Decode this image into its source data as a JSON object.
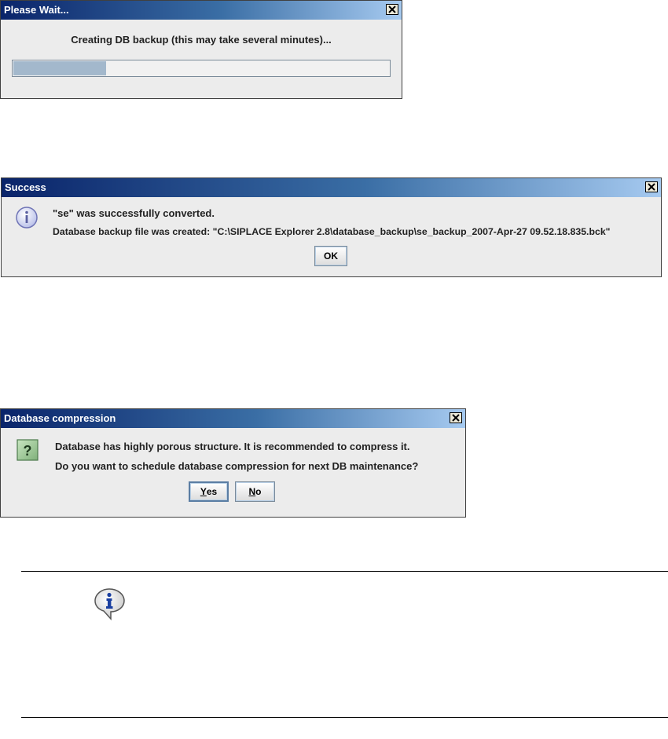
{
  "wait_dialog": {
    "title": "Please Wait...",
    "message": "Creating DB backup (this may take several minutes)...",
    "progress": 0.25
  },
  "success_dialog": {
    "title": "Success",
    "line1": "\"se\" was successfully converted.",
    "line2": "Database backup file was created: \"C:\\SIPLACE Explorer 2.8\\database_backup\\se_backup_2007-Apr-27 09.52.18.835.bck\"",
    "ok_label": "OK",
    "icon": "info-icon"
  },
  "compression_dialog": {
    "title": "Database compression",
    "line1": "Database has highly porous structure. It is recommended to compress it.",
    "line2": "Do you want to schedule database compression for next DB maintenance?",
    "yes_label": "Yes",
    "yes_mnemonic": "Y",
    "yes_rest": "es",
    "no_label": "No",
    "no_mnemonic": "N",
    "no_rest": "o",
    "icon": "question-icon"
  },
  "note": {
    "icon": "info-bubble-icon"
  },
  "colors": {
    "titlebar_start": "#0a246a",
    "titlebar_end": "#a6caf0",
    "dialog_bg": "#ececec",
    "progress_fill": "#a3b8cc"
  }
}
